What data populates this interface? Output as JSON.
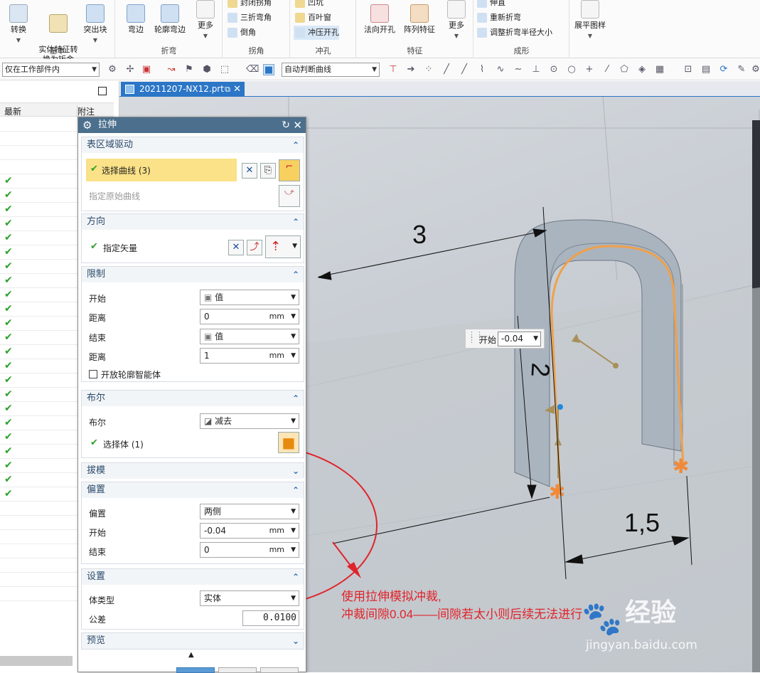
{
  "ribbon": {
    "basic": {
      "label": "基本",
      "convert": "转换",
      "solid_to_sheet": "实体特征转\n换为钣金",
      "extract": "突出块"
    },
    "flange": {
      "label": "折弯",
      "bend": "弯边",
      "contour": "轮廓弯边",
      "more": "更多"
    },
    "corner": {
      "label": "拐角",
      "item1": "封闭拐角",
      "item2": "三折弯角",
      "item3": "倒角"
    },
    "punch": {
      "label": "冲孔",
      "item1": "凹坑",
      "item2": "百叶窗",
      "item3": "冲压开孔"
    },
    "feature": {
      "label": "特征",
      "normal_hole": "法向开孔",
      "array": "阵列特征",
      "more": "更多"
    },
    "form": {
      "label": "成形",
      "item1": "伸直",
      "item2": "重新折弯",
      "item3": "调整折弯半径大小"
    },
    "flat": {
      "label": "展平图样"
    }
  },
  "toolbar": {
    "filter": "仅在工作部件内",
    "curve_rule": "自动判断曲线"
  },
  "navigator": {
    "col_latest": "最新",
    "col_notes": "附注",
    "check_count": 23
  },
  "doc_tab": "20211207-NX12.prt",
  "dialog": {
    "title": "拉伸",
    "section_curves": "表区域驱动",
    "select_curve": "选择曲线 (3)",
    "specify_original": "指定原始曲线",
    "section_direction": "方向",
    "specify_vector": "指定矢量",
    "section_limits": "限制",
    "start_label": "开始",
    "start_type": "值",
    "distance_label": "距离",
    "start_distance": "0",
    "end_label": "结束",
    "end_type": "值",
    "end_distance": "1",
    "unit": "mm",
    "open_profile": "开放轮廓智能体",
    "section_boolean": "布尔",
    "boolean_label": "布尔",
    "boolean_value": "减去",
    "select_body": "选择体 (1)",
    "section_draft": "拔模",
    "section_offset": "偏置",
    "offset_label": "偏置",
    "offset_value": "两侧",
    "offset_start_label": "开始",
    "offset_start": "-0.04",
    "offset_end_label": "结束",
    "offset_end": "0",
    "section_settings": "设置",
    "body_type_label": "体类型",
    "body_type": "实体",
    "tolerance_label": "公差",
    "tolerance": "0.0100",
    "section_preview": "预览"
  },
  "viewport": {
    "dim_3": "3",
    "dim_2": "2",
    "dim_15": "1,5",
    "handle_label": "开始",
    "handle_value": "-0.04",
    "note_line1": "使用拉伸模拟冲裁,",
    "note_line2": "冲裁间隙0.04——间隙若太小则后续无法进行",
    "watermark": "经验",
    "watermark_url": "jingyan.baidu.com"
  }
}
